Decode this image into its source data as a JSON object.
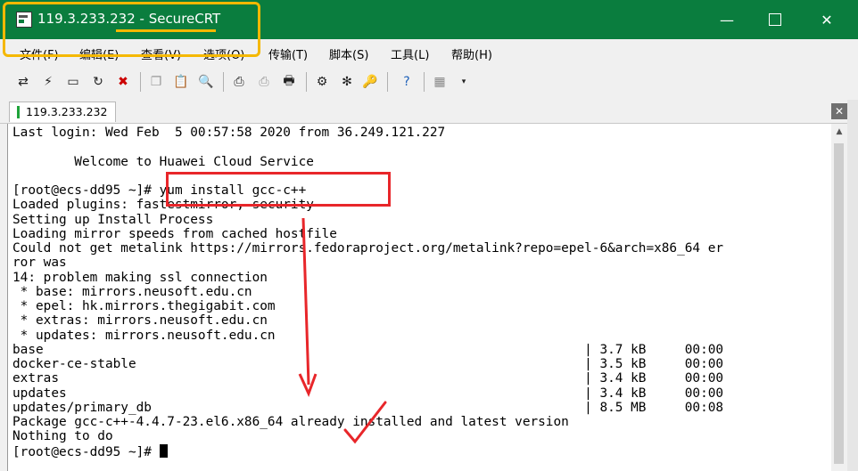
{
  "window": {
    "title": "119.3.233.232 - SecureCRT",
    "minimize_glyph": "—",
    "close_glyph": "✕"
  },
  "menu": {
    "items": [
      "文件(F)",
      "编辑(E)",
      "查看(V)",
      "选项(O)",
      "传输(T)",
      "脚本(S)",
      "工具(L)",
      "帮助(H)"
    ]
  },
  "toolbar": {
    "icons": [
      "connect-icon",
      "quick-connect-icon",
      "connect-in-tab-icon",
      "reconnect-icon",
      "disconnect-icon",
      "copy-icon",
      "paste-icon",
      "find-icon",
      "print-icon",
      "print-selection-icon",
      "print-setup-icon",
      "session-options-icon",
      "global-options-icon",
      "keymap-icon",
      "help-icon",
      "sftp-icon"
    ]
  },
  "tab": {
    "label": "119.3.233.232",
    "close_glyph": "✕"
  },
  "terminal": {
    "lines": [
      "Last login: Wed Feb  5 00:57:58 2020 from 36.249.121.227",
      "",
      "        Welcome to Huawei Cloud Service",
      "",
      "[root@ecs-dd95 ~]# yum install gcc-c++",
      "Loaded plugins: fastestmirror, security",
      "Setting up Install Process",
      "Loading mirror speeds from cached hostfile",
      "Could not get metalink https://mirrors.fedoraproject.org/metalink?repo=epel-6&arch=x86_64 er",
      "ror was",
      "14: problem making ssl connection",
      " * base: mirrors.neusoft.edu.cn",
      " * epel: hk.mirrors.thegigabit.com",
      " * extras: mirrors.neusoft.edu.cn",
      " * updates: mirrors.neusoft.edu.cn",
      "base                                                                      | 3.7 kB     00:00",
      "docker-ce-stable                                                          | 3.5 kB     00:00",
      "extras                                                                    | 3.4 kB     00:00",
      "updates                                                                   | 3.4 kB     00:00",
      "updates/primary_db                                                        | 8.5 MB     00:08",
      "Package gcc-c++-4.4.7-23.el6.x86_64 already installed and latest version",
      "Nothing to do",
      "[root@ecs-dd95 ~]# "
    ],
    "scroll_up_glyph": "▲"
  },
  "colors": {
    "titlebar": "#0a7d3e",
    "annotation_yellow": "#f5b800",
    "annotation_red": "#e8262a"
  }
}
